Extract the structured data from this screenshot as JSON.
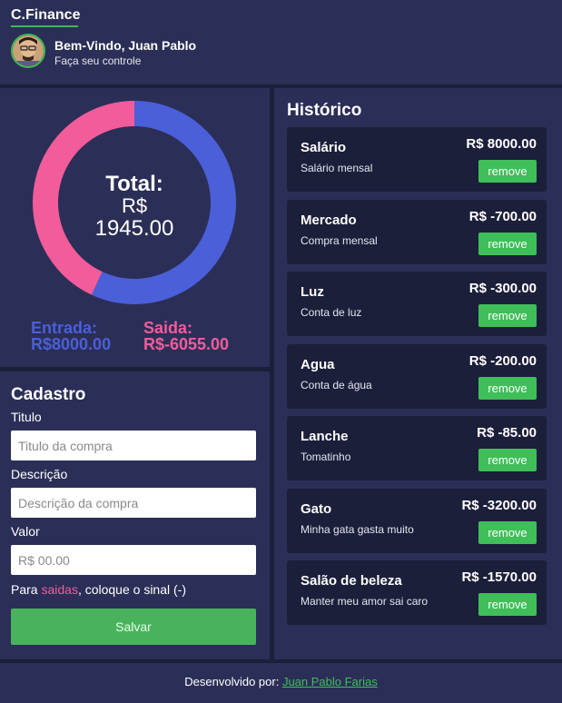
{
  "header": {
    "brand": "C.Finance",
    "welcome": "Bem-Vindo, Juan Pablo",
    "subtitle": "Faça seu controle"
  },
  "summary": {
    "total_label": "Total:",
    "currency": "R$",
    "total_value": "1945.00",
    "entrada_label": "Entrada:",
    "entrada_value": "R$8000.00",
    "saida_label": "Saida:",
    "saida_value": "R$-6055.00"
  },
  "chart_data": {
    "type": "pie",
    "variant": "donut",
    "slices": [
      {
        "name": "Entrada",
        "value": 8000,
        "color": "#4a5fd8"
      },
      {
        "name": "Saida",
        "value": 6055,
        "color": "#f25c9a"
      }
    ]
  },
  "form": {
    "title": "Cadastro",
    "titulo_label": "Titulo",
    "titulo_placeholder": "Titulo da compra",
    "descricao_label": "Descrição",
    "descricao_placeholder": "Descrição da compra",
    "valor_label": "Valor",
    "valor_placeholder": "R$ 00.00",
    "hint_prefix": "Para ",
    "hint_highlight": "saidas",
    "hint_suffix": ", coloque o sinal (-)",
    "save_label": "Salvar"
  },
  "history": {
    "title": "Histórico",
    "remove_label": "remove",
    "items": [
      {
        "title": "Salário",
        "desc": "Salário mensal",
        "value": "R$ 8000.00"
      },
      {
        "title": "Mercado",
        "desc": "Compra mensal",
        "value": "R$ -700.00"
      },
      {
        "title": "Luz",
        "desc": "Conta de luz",
        "value": "R$ -300.00"
      },
      {
        "title": "Agua",
        "desc": "Conta de água",
        "value": "R$ -200.00"
      },
      {
        "title": "Lanche",
        "desc": "Tomatinho",
        "value": "R$ -85.00"
      },
      {
        "title": "Gato",
        "desc": "Minha gata gasta muito",
        "value": "R$ -3200.00"
      },
      {
        "title": "Salão de beleza",
        "desc": "Manter meu amor sai caro",
        "value": "R$ -1570.00"
      }
    ]
  },
  "footer": {
    "text": "Desenvolvido por:",
    "link": "Juan Pablo Farias"
  },
  "colors": {
    "accent_green": "#3fbe5a",
    "entrada": "#4a5fd8",
    "saida": "#f25c9a",
    "panel": "#2b2f57",
    "background": "#1b1f3a"
  }
}
